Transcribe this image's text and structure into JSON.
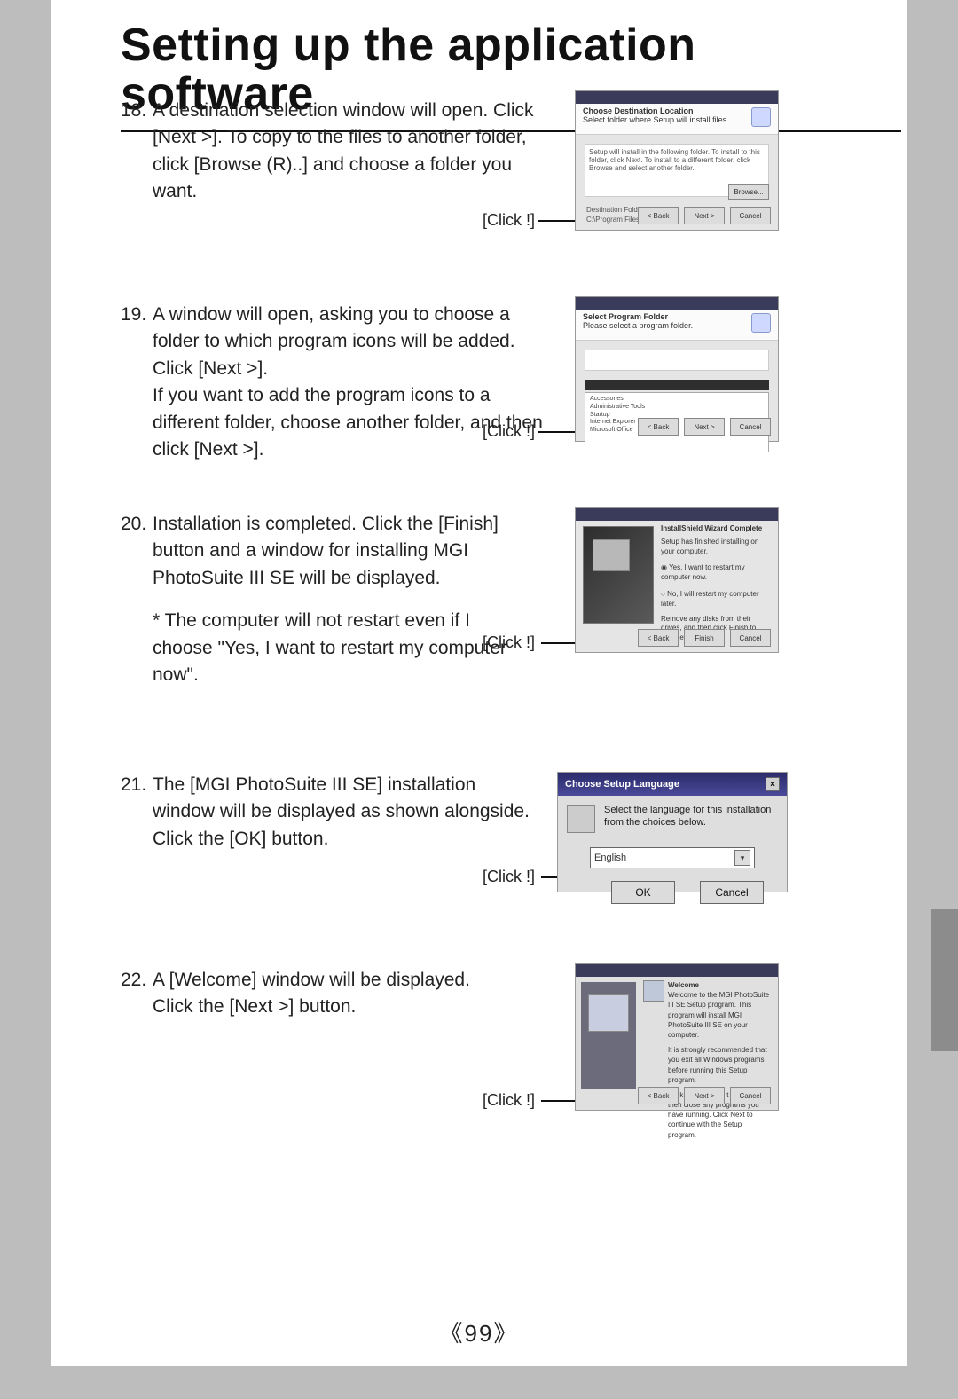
{
  "title": "Setting up the application software",
  "page_number": "99",
  "click_label": "[Click !]",
  "steps": {
    "s18": {
      "num": "18.",
      "text": "A destination selection window will open. Click [Next >]. To copy to the files to another folder, click [Browse (R)..] and choose a folder you want."
    },
    "s19": {
      "num": "19.",
      "text": "A window will open, asking you to choose a folder to which program icons will be added. Click [Next >].\nIf you want to add the program icons to a different folder, choose another folder, and then click [Next >]."
    },
    "s20": {
      "num": "20.",
      "text": "Installation is completed. Click the [Finish] button and a window for installing MGI PhotoSuite III SE will be displayed.",
      "note": "* The computer will not restart even if I choose \"Yes, I want to restart my computer now\"."
    },
    "s21": {
      "num": "21.",
      "text": "The [MGI PhotoSuite III SE] installation window will be displayed as shown alongside. Click the [OK] button."
    },
    "s22": {
      "num": "22.",
      "text": "A [Welcome] window will be displayed.\nClick the [Next >] button."
    }
  },
  "dialogs": {
    "d18": {
      "header": "Choose Destination Location",
      "sub": "Select folder where Setup will install files.",
      "area": "Setup will install in the following folder.\nTo install to this folder, click Next. To install to a different folder, click Browse and select another folder.",
      "dest_label": "Destination Folder",
      "dest_path": "C:\\Program Files\\...",
      "browse": "Browse...",
      "back": "< Back",
      "next": "Next >",
      "cancel": "Cancel"
    },
    "d19": {
      "header": "Select Program Folder",
      "sub": "Please select a program folder.",
      "band": "",
      "list": "Accessories\nAdministrative Tools\nStartup\nInternet Explorer\nMicrosoft Office",
      "back": "< Back",
      "next": "Next >",
      "cancel": "Cancel"
    },
    "d20": {
      "title": "InstallShield Wizard Complete",
      "body": "Setup has finished installing on your computer.",
      "radio1": "Yes, I want to restart my computer now.",
      "radio2": "No, I will restart my computer later.",
      "foot": "Remove any disks from their drives, and then click Finish to complete setup.",
      "back": "< Back",
      "finish": "Finish",
      "cancel": "Cancel"
    },
    "d21": {
      "title": "Choose Setup Language",
      "msg": "Select the language for this installation from the choices below.",
      "option": "English",
      "ok": "OK",
      "cancel": "Cancel"
    },
    "d22": {
      "title": "Welcome",
      "body1": "Welcome to the MGI PhotoSuite III SE Setup program. This program will install MGI PhotoSuite III SE on your computer.",
      "body2": "It is strongly recommended that you exit all Windows programs before running this Setup program.",
      "body3": "Click Cancel to quit Setup and then close any programs you have running. Click Next to continue with the Setup program.",
      "back": "< Back",
      "next": "Next >",
      "cancel": "Cancel"
    }
  }
}
